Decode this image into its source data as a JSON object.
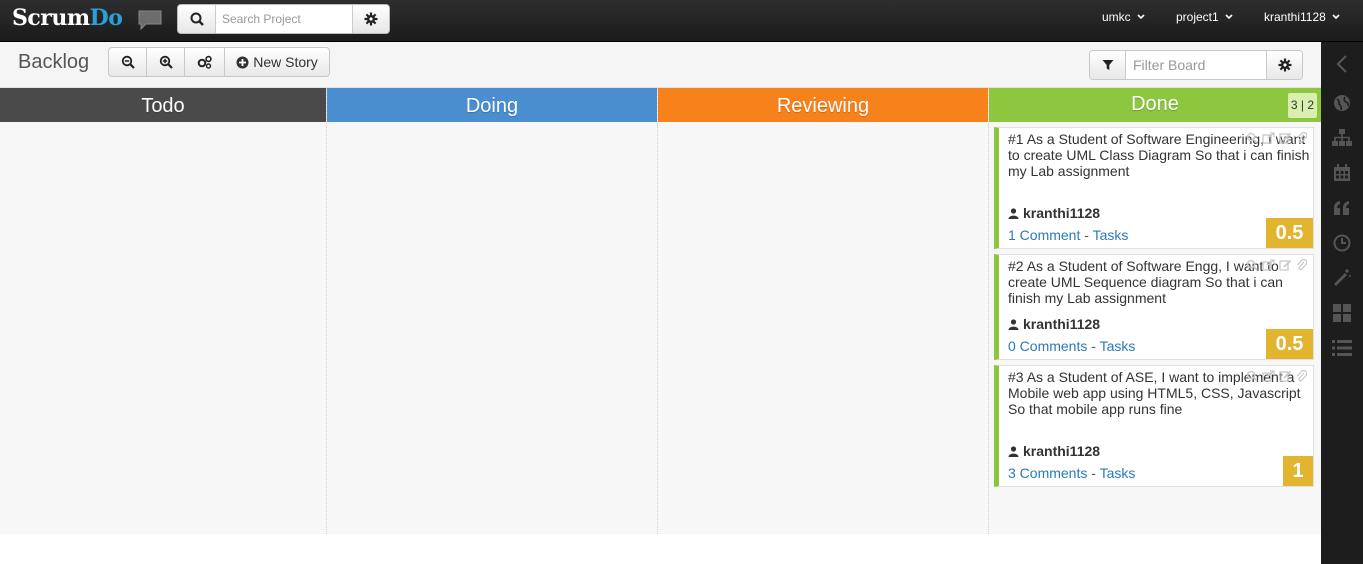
{
  "app": {
    "logo_part1": "Scrum",
    "logo_part2": "Do"
  },
  "search": {
    "placeholder": "Search Project"
  },
  "topmenu": {
    "org": "umkc",
    "project": "project1",
    "user": "kranthi1128"
  },
  "toolbar": {
    "title": "Backlog",
    "new_story_label": "New Story",
    "filter_placeholder": "Filter Board"
  },
  "columns": [
    {
      "name": "Todo",
      "color": "#4a4a4a"
    },
    {
      "name": "Doing",
      "color": "#4a8ecf"
    },
    {
      "name": "Reviewing",
      "color": "#f7821b"
    },
    {
      "name": "Done",
      "color": "#8dc63f",
      "count": "3 | 2"
    }
  ],
  "cards": [
    {
      "text": "#1 As a Student of Software Engineering, I want to create UML Class Diagram So that i can finish my Lab assignment",
      "user": "kranthi1128",
      "comments": "1 Comment",
      "dash": "-",
      "tasks": "Tasks",
      "points": "0.5"
    },
    {
      "text": "#2 As a Student of Software Engg, I want to create UML Sequence diagram So that i can finish my Lab assignment",
      "user": "kranthi1128",
      "comments": "0 Comments",
      "dash": "-",
      "tasks": "Tasks",
      "points": "0.5"
    },
    {
      "text": "#3 As a Student of ASE, I want to implement a Mobile web app using HTML5, CSS, Javascript So that mobile app runs fine",
      "user": "kranthi1128",
      "comments": "3 Comments",
      "dash": "-",
      "tasks": "Tasks",
      "points": "1"
    }
  ],
  "sidebar_icons": [
    "chevron-left-icon",
    "globe-icon",
    "sitemap-icon",
    "calendar-icon",
    "quote-icon",
    "clock-icon",
    "magic-wand-icon",
    "dashboard-icon",
    "list-icon"
  ]
}
